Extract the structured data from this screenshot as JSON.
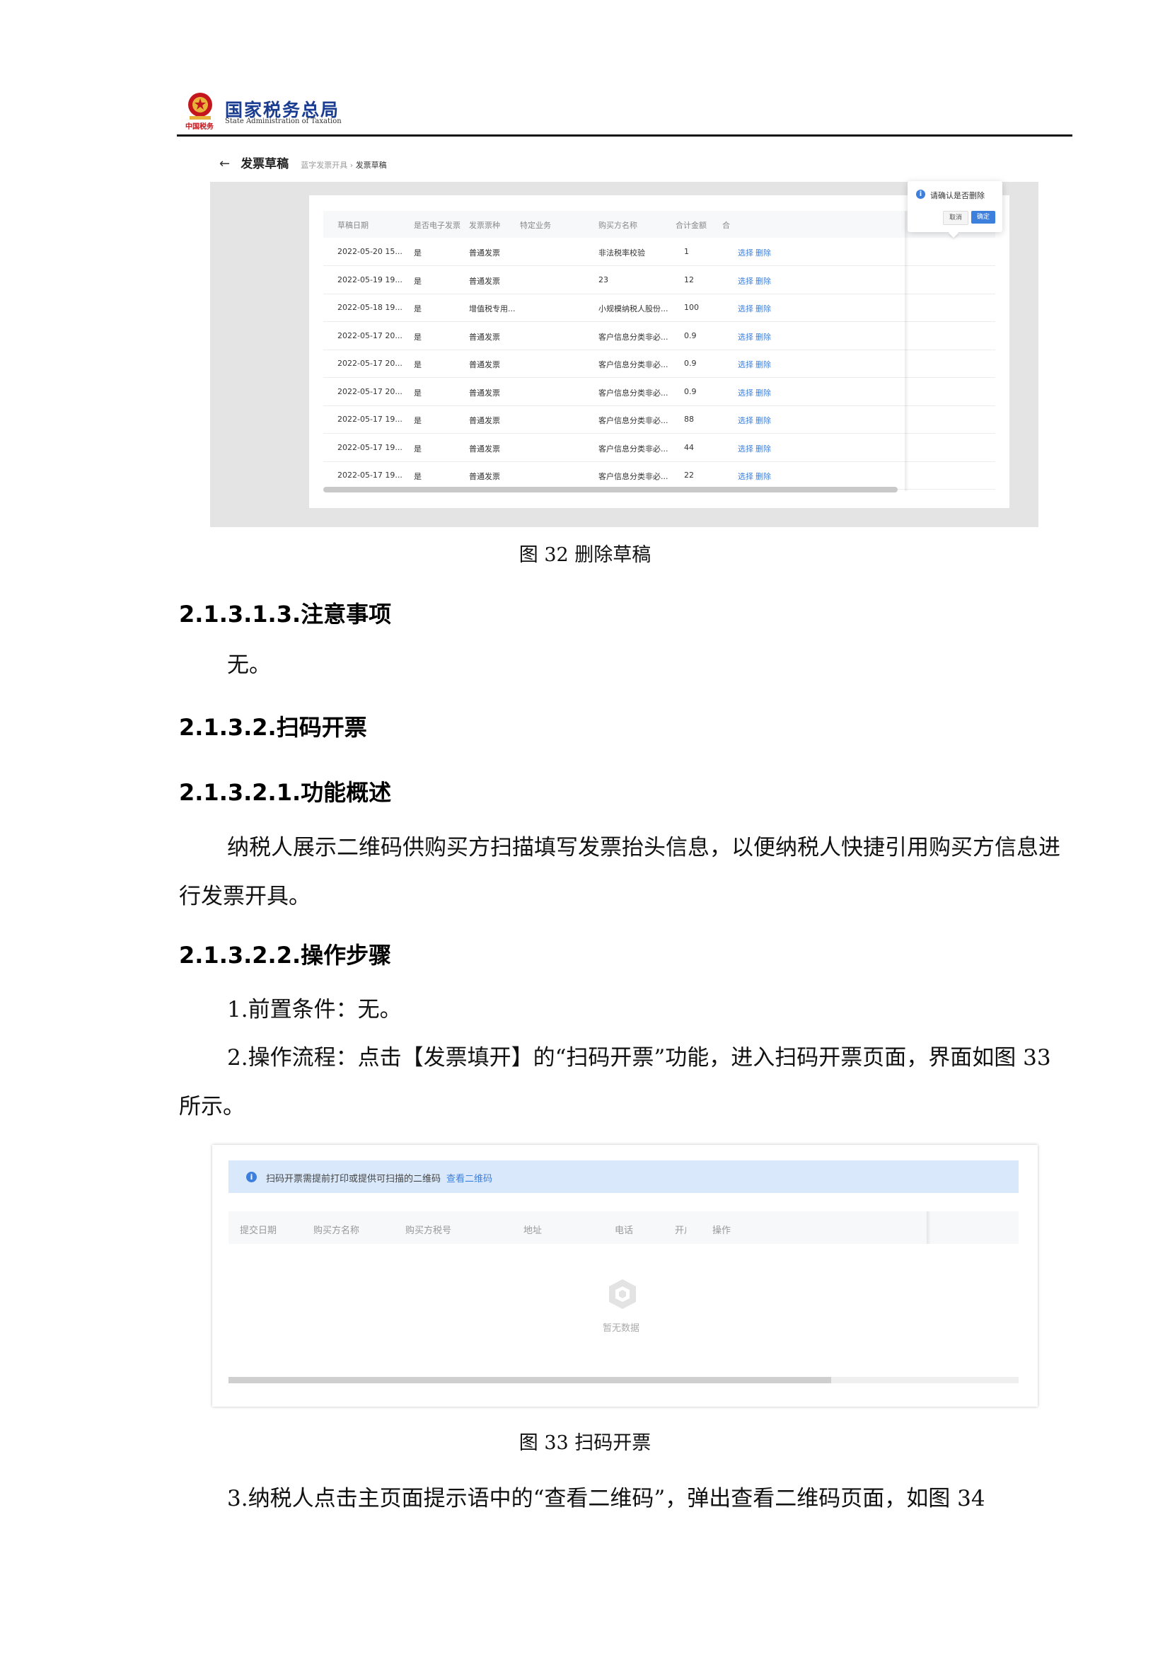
{
  "header": {
    "org_cn": "国家税务总局",
    "org_en": "State Administration of Taxation",
    "org_sub": "中国税务"
  },
  "figure32": {
    "back_icon": "arrow-left-icon",
    "page_title": "发票草稿",
    "breadcrumb": [
      "蓝字发票开具",
      "发票草稿"
    ],
    "columns": [
      "草稿日期",
      "是否电子发票",
      "发票票种",
      "特定业务",
      "购买方名称",
      "合计金额",
      "合"
    ],
    "rows": [
      {
        "date": "2022-05-20 15...",
        "electronic": "是",
        "type": "普通发票",
        "special": "",
        "buyer": "非法税率校验",
        "amount": "1",
        "select": "选择",
        "delete": "删除"
      },
      {
        "date": "2022-05-19 19...",
        "electronic": "是",
        "type": "普通发票",
        "special": "",
        "buyer": "23",
        "amount": "12",
        "select": "选择",
        "delete": "删除"
      },
      {
        "date": "2022-05-18 19...",
        "electronic": "是",
        "type": "增值税专用...",
        "special": "",
        "buyer": "小规模纳税人股份...",
        "amount": "100",
        "select": "选择",
        "delete": "删除"
      },
      {
        "date": "2022-05-17 20...",
        "electronic": "是",
        "type": "普通发票",
        "special": "",
        "buyer": "客户信息分类非必...",
        "amount": "0.9",
        "select": "选择",
        "delete": "删除"
      },
      {
        "date": "2022-05-17 20...",
        "electronic": "是",
        "type": "普通发票",
        "special": "",
        "buyer": "客户信息分类非必...",
        "amount": "0.9",
        "select": "选择",
        "delete": "删除"
      },
      {
        "date": "2022-05-17 20...",
        "electronic": "是",
        "type": "普通发票",
        "special": "",
        "buyer": "客户信息分类非必...",
        "amount": "0.9",
        "select": "选择",
        "delete": "删除"
      },
      {
        "date": "2022-05-17 19...",
        "electronic": "是",
        "type": "普通发票",
        "special": "",
        "buyer": "客户信息分类非必...",
        "amount": "88",
        "select": "选择",
        "delete": "删除"
      },
      {
        "date": "2022-05-17 19...",
        "electronic": "是",
        "type": "普通发票",
        "special": "",
        "buyer": "客户信息分类非必...",
        "amount": "44",
        "select": "选择",
        "delete": "删除"
      },
      {
        "date": "2022-05-17 19...",
        "electronic": "是",
        "type": "普通发票",
        "special": "",
        "buyer": "客户信息分类非必...",
        "amount": "22",
        "select": "选择",
        "delete": "删除"
      }
    ],
    "popconfirm": {
      "text": "请确认是否删除",
      "cancel": "取消",
      "ok": "确定"
    },
    "caption": "图 32 删除草稿"
  },
  "section_2131_3": {
    "heading": "2.1.3.1.3.注意事项",
    "body": "无。"
  },
  "section_2132": {
    "heading": "2.1.3.2.扫码开票"
  },
  "section_2132_1": {
    "heading": "2.1.3.2.1.功能概述",
    "body": "纳税人展示二维码供购买方扫描填写发票抬头信息，以便纳税人快捷引用购买方信息进行发票开具。"
  },
  "section_2132_2": {
    "heading": "2.1.3.2.2.操作步骤",
    "step1": "1.前置条件：无。",
    "step2": "2.操作流程：点击【发票填开】的“扫码开票”功能，进入扫码开票页面，界面如图 33 所示。"
  },
  "figure33": {
    "alert_text": "扫码开票需提前打印或提供可扫描的二维码",
    "alert_link": "查看二维码",
    "columns": [
      "提交日期",
      "购买方名称",
      "购买方税号",
      "地址",
      "电话",
      "开户",
      "操作"
    ],
    "empty_text": "暂无数据",
    "caption": "图 33 扫码开票"
  },
  "step3": "3.纳税人点击主页面提示语中的“查看二维码”，弹出查看二维码页面，如图 34"
}
